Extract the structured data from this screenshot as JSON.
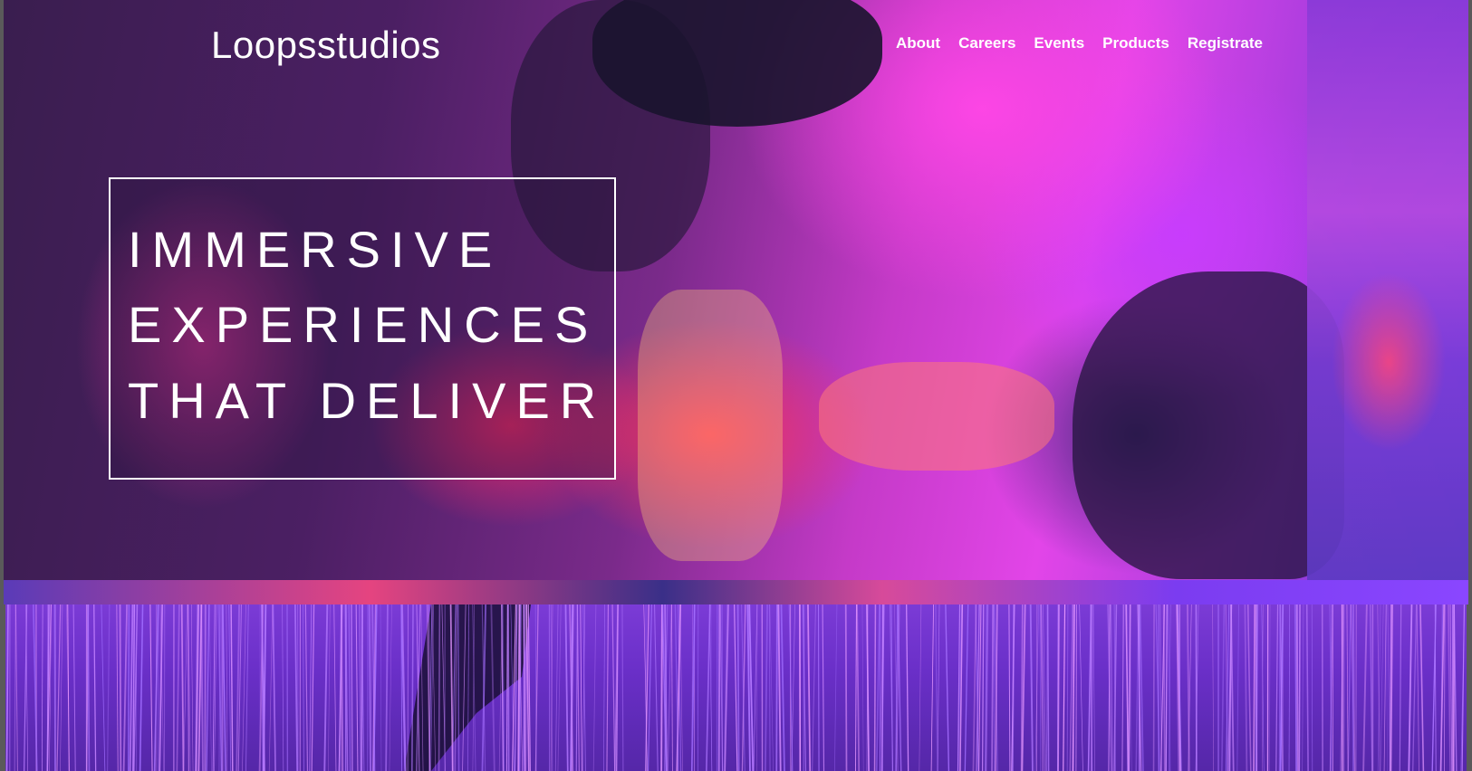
{
  "header": {
    "logo": "Loopsstudios",
    "nav": [
      "About",
      "Careers",
      "Events",
      "Products",
      "Registrate"
    ]
  },
  "hero": {
    "headline": [
      "IMMERSIVE",
      "EXPERIENCES",
      "THAT DELIVER"
    ]
  },
  "colors": {
    "accent_pink": "#e245e8",
    "accent_purple": "#7b3bd6",
    "text": "#ffffff"
  }
}
